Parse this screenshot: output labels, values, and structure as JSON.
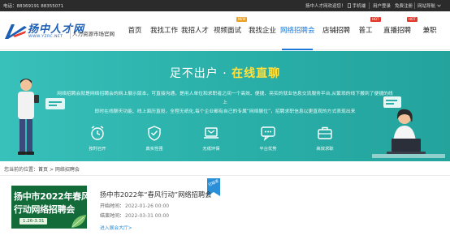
{
  "topbar": {
    "phone": "电话：88369191 88355071",
    "welcome": "扬中人才网欢迎您！",
    "links": [
      "手机端",
      "用户登录",
      "免费注册",
      "网站导航"
    ]
  },
  "header": {
    "logo_name": "扬中人才网",
    "logo_url": "WWW.YZRC.NET",
    "logo_tagline": "人力资源市场官网",
    "nav": [
      {
        "label": "首页",
        "badge": ""
      },
      {
        "label": "我找工作",
        "badge": ""
      },
      {
        "label": "我招人才",
        "badge": ""
      },
      {
        "label": "视频面试",
        "badge": "NEW"
      },
      {
        "label": "我找企业",
        "badge": ""
      },
      {
        "label": "网络招聘会",
        "badge": ""
      },
      {
        "label": "店铺招聘",
        "badge": ""
      },
      {
        "label": "普工",
        "badge": "HOT"
      },
      {
        "label": "直播招聘",
        "badge": "HOT"
      },
      {
        "label": "兼职",
        "badge": ""
      }
    ]
  },
  "banner": {
    "hero_left": "足不出户",
    "hero_dot": "·",
    "hero_right": "在线直聊",
    "intro_line1": "网络招聘会就是网络招聘会的网上展示版本，可直接沟通，是用人单位和求职者之间一个高效、便捷、亮实的就业信息交流服务平台,从繁琐的线下搬到了便捷的线上",
    "intro_line2": "即时在线聊天功能、线上面历直投，全程无纸化,每个企业都有自己的专属“网络展位”，招聘求职信息以更直观的方式表现出来",
    "features": [
      {
        "label": "按时召开",
        "icon": "alarm-clock-icon"
      },
      {
        "label": "真实性强",
        "icon": "shield-check-icon"
      },
      {
        "label": "无纸环保",
        "icon": "laptop-mail-icon"
      },
      {
        "label": "平台优势",
        "icon": "platform-chat-icon"
      },
      {
        "label": "高效求职",
        "icon": "briefcase-icon"
      }
    ]
  },
  "breadcrumb": {
    "prefix": "您当前的位置：",
    "home": "首页",
    "separator": ">",
    "current": "网络招聘会"
  },
  "event": {
    "image_line1": "扬中市2022年春风",
    "image_line2": "行动网络招聘会",
    "image_date": "1.26-3.31",
    "ribbon": "已结束",
    "title": "扬中市2022年“春风行动”网络招聘会",
    "start_label": "开始时间：",
    "start_value": "2022-01-26 00:00",
    "end_label": "结束时间：",
    "end_value": "2022-03-31 00:00",
    "link": "进入展会大厅>"
  },
  "colors": {
    "accent": "#1a79d8",
    "banner": "#2ab0a9",
    "highlight": "#ffe23f",
    "badge_new": "#e9a227",
    "badge_hot": "#e23a2a"
  }
}
